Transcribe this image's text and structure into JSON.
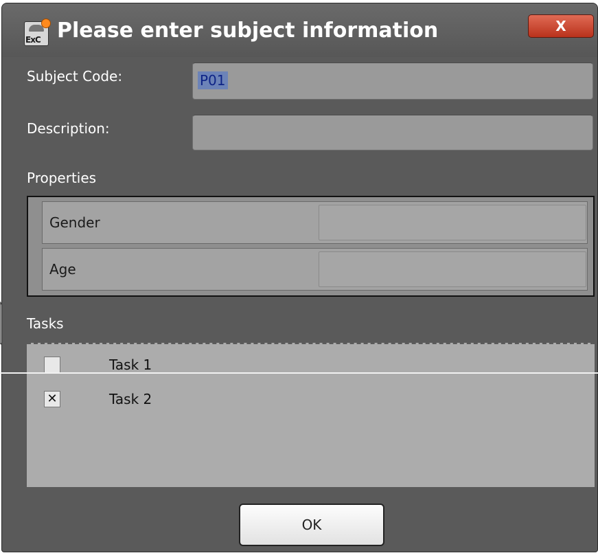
{
  "dialog": {
    "title": "Please enter subject information",
    "close_label": "X",
    "icon_text": "ExC"
  },
  "fields": {
    "subject_code_label": "Subject Code:",
    "subject_code_value": "P01",
    "description_label": "Description:",
    "description_value": ""
  },
  "properties": {
    "heading": "Properties",
    "rows": [
      {
        "name": "Gender",
        "value": ""
      },
      {
        "name": "Age",
        "value": ""
      }
    ]
  },
  "tasks": {
    "heading": "Tasks",
    "items": [
      {
        "label": "Task 1",
        "checked": false,
        "mark": ""
      },
      {
        "label": "Task 2",
        "checked": true,
        "mark": "✕"
      }
    ]
  },
  "buttons": {
    "ok_label": "OK"
  },
  "colors": {
    "dialog_bg": "#5a5a5a",
    "close_button": "#c8412a",
    "selection": "#6c83b8"
  }
}
